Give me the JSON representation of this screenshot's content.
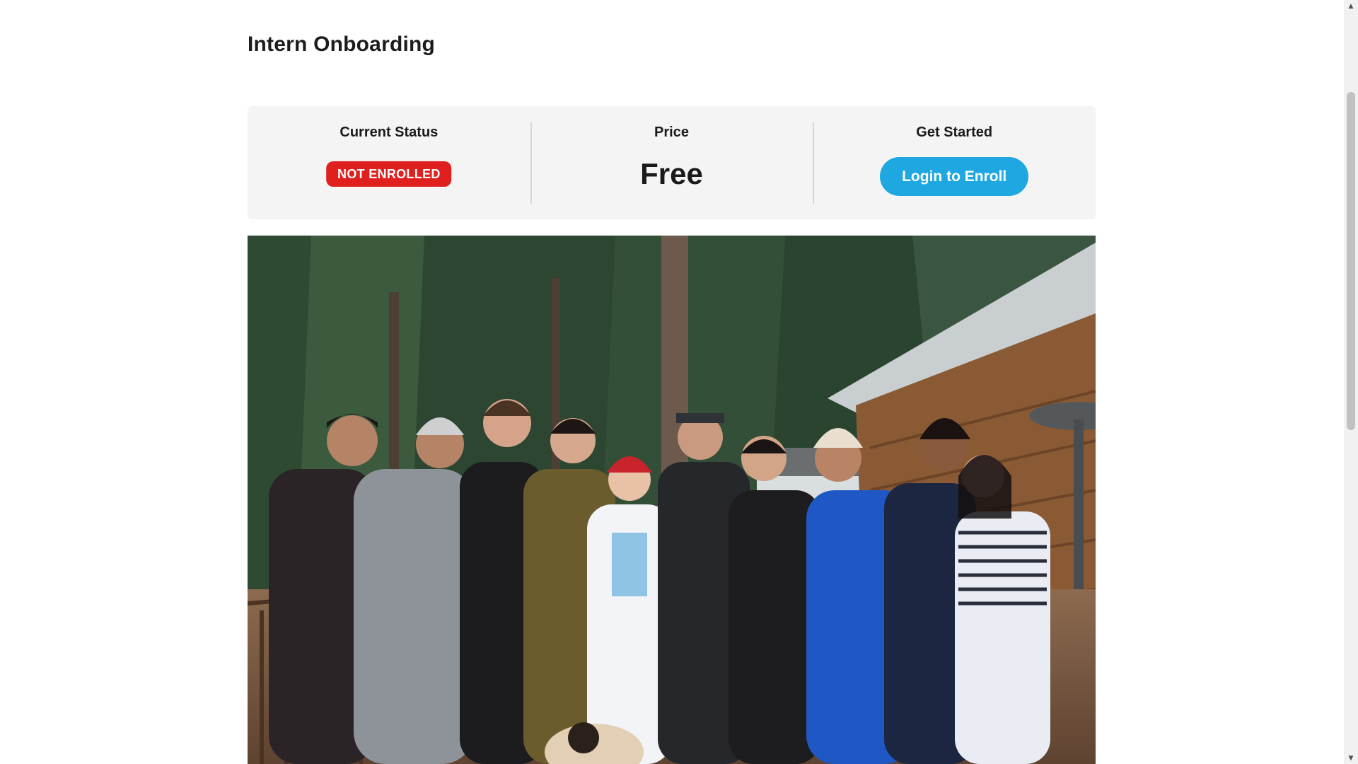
{
  "page": {
    "title": "Intern Onboarding"
  },
  "panel": {
    "status": {
      "heading": "Current Status",
      "badge": "NOT ENROLLED",
      "badge_color": "#e0201f"
    },
    "price": {
      "heading": "Price",
      "value": "Free"
    },
    "get_started": {
      "heading": "Get Started",
      "button_label": "Login to Enroll",
      "button_color": "#1fa7e2"
    }
  },
  "hero": {
    "alt": "Group photo of interns standing on a wooden deck in front of a cabin among pine trees"
  },
  "scrollbar": {
    "up_icon": "arrow-up-icon",
    "down_icon": "arrow-down-icon"
  }
}
